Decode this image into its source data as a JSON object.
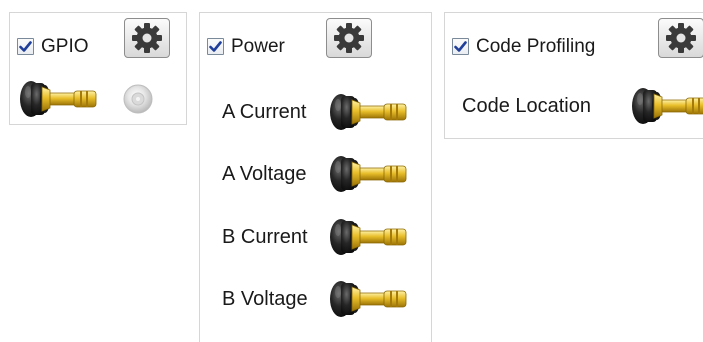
{
  "panels": {
    "gpio": {
      "title": "GPIO",
      "enabled": true
    },
    "power": {
      "title": "Power",
      "enabled": true,
      "channels": [
        {
          "label": "A Current"
        },
        {
          "label": "A Voltage"
        },
        {
          "label": "B Current"
        },
        {
          "label": "B Voltage"
        }
      ]
    },
    "code_profiling": {
      "title": "Code Profiling",
      "enabled": true,
      "channels": [
        {
          "label": "Code Location"
        }
      ]
    }
  },
  "icons": {
    "settings": "gear-icon",
    "probe": "probe-connector-icon",
    "indicator": "led-indicator-icon",
    "checkbox": "checkmark-icon"
  },
  "colors": {
    "checkmark": "#1f3f9a",
    "gear": "#3a3a3a",
    "plug_dark": "#2b2b2b",
    "plug_gold": "#e0b320",
    "led": "#d9d9d9"
  }
}
